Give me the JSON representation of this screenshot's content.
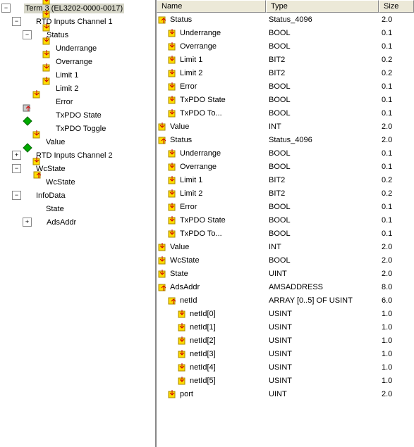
{
  "tree": {
    "root": "Term 3 (EL3202-0000-0017)",
    "items": [
      "RTD Inputs Channel 1",
      "Status",
      "Underrange",
      "Overrange",
      "Limit 1",
      "Limit 2",
      "Error",
      "TxPDO State",
      "TxPDO Toggle",
      "Value",
      "RTD Inputs Channel 2",
      "WcState",
      "WcState",
      "InfoData",
      "State",
      "AdsAddr"
    ]
  },
  "columns": {
    "name": "Name",
    "type": "Type",
    "size": "Size"
  },
  "rows": [
    {
      "i": 0,
      "n": "Status",
      "t": "Status_4096",
      "s": "2.0",
      "k": "s"
    },
    {
      "i": 1,
      "n": "Underrange",
      "t": "BOOL",
      "s": "0.1",
      "k": "v"
    },
    {
      "i": 1,
      "n": "Overrange",
      "t": "BOOL",
      "s": "0.1",
      "k": "v"
    },
    {
      "i": 1,
      "n": "Limit 1",
      "t": "BIT2",
      "s": "0.2",
      "k": "v"
    },
    {
      "i": 1,
      "n": "Limit 2",
      "t": "BIT2",
      "s": "0.2",
      "k": "v"
    },
    {
      "i": 1,
      "n": "Error",
      "t": "BOOL",
      "s": "0.1",
      "k": "v"
    },
    {
      "i": 1,
      "n": "TxPDO State",
      "t": "BOOL",
      "s": "0.1",
      "k": "v"
    },
    {
      "i": 1,
      "n": "TxPDO To...",
      "t": "BOOL",
      "s": "0.1",
      "k": "v"
    },
    {
      "i": 0,
      "n": "Value",
      "t": "INT",
      "s": "2.0",
      "k": "v"
    },
    {
      "i": 0,
      "n": "Status",
      "t": "Status_4096",
      "s": "2.0",
      "k": "s"
    },
    {
      "i": 1,
      "n": "Underrange",
      "t": "BOOL",
      "s": "0.1",
      "k": "v"
    },
    {
      "i": 1,
      "n": "Overrange",
      "t": "BOOL",
      "s": "0.1",
      "k": "v"
    },
    {
      "i": 1,
      "n": "Limit 1",
      "t": "BIT2",
      "s": "0.2",
      "k": "v"
    },
    {
      "i": 1,
      "n": "Limit 2",
      "t": "BIT2",
      "s": "0.2",
      "k": "v"
    },
    {
      "i": 1,
      "n": "Error",
      "t": "BOOL",
      "s": "0.1",
      "k": "v"
    },
    {
      "i": 1,
      "n": "TxPDO State",
      "t": "BOOL",
      "s": "0.1",
      "k": "v"
    },
    {
      "i": 1,
      "n": "TxPDO To...",
      "t": "BOOL",
      "s": "0.1",
      "k": "v"
    },
    {
      "i": 0,
      "n": "Value",
      "t": "INT",
      "s": "2.0",
      "k": "v"
    },
    {
      "i": 0,
      "n": "WcState",
      "t": "BOOL",
      "s": "2.0",
      "k": "v"
    },
    {
      "i": 0,
      "n": "State",
      "t": "UINT",
      "s": "2.0",
      "k": "v"
    },
    {
      "i": 0,
      "n": "AdsAddr",
      "t": "AMSADDRESS",
      "s": "8.0",
      "k": "s"
    },
    {
      "i": 1,
      "n": "netId",
      "t": "ARRAY [0..5] OF USINT",
      "s": "6.0",
      "k": "s"
    },
    {
      "i": 2,
      "n": "netId[0]",
      "t": "USINT",
      "s": "1.0",
      "k": "v"
    },
    {
      "i": 2,
      "n": "netId[1]",
      "t": "USINT",
      "s": "1.0",
      "k": "v"
    },
    {
      "i": 2,
      "n": "netId[2]",
      "t": "USINT",
      "s": "1.0",
      "k": "v"
    },
    {
      "i": 2,
      "n": "netId[3]",
      "t": "USINT",
      "s": "1.0",
      "k": "v"
    },
    {
      "i": 2,
      "n": "netId[4]",
      "t": "USINT",
      "s": "1.0",
      "k": "v"
    },
    {
      "i": 2,
      "n": "netId[5]",
      "t": "USINT",
      "s": "1.0",
      "k": "v"
    },
    {
      "i": 1,
      "n": "port",
      "t": "UINT",
      "s": "2.0",
      "k": "v"
    }
  ]
}
